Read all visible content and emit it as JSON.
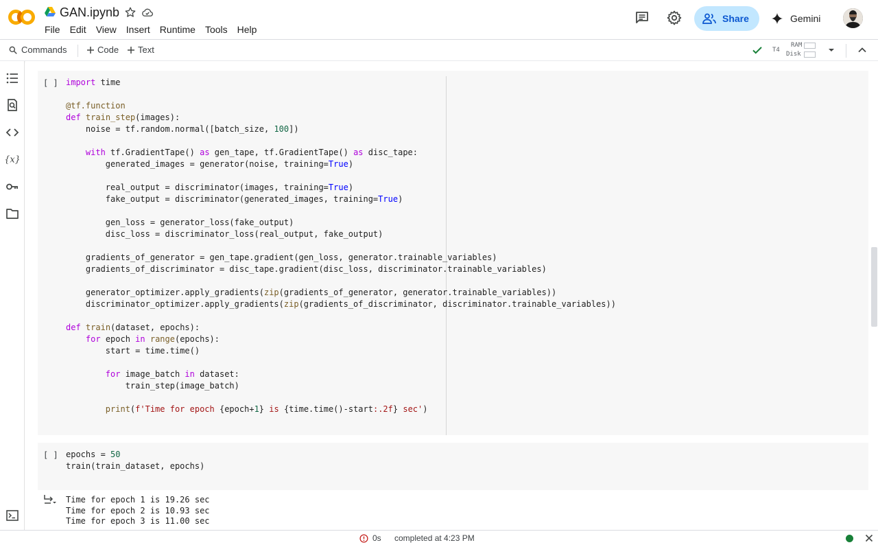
{
  "header": {
    "title": "GAN.ipynb",
    "menu": [
      "File",
      "Edit",
      "View",
      "Insert",
      "Runtime",
      "Tools",
      "Help"
    ],
    "share_label": "Share",
    "gemini_label": "Gemini"
  },
  "toolbar": {
    "commands_label": "Commands",
    "add_code_label": "Code",
    "add_text_label": "Text",
    "runtime_type": "T4",
    "ram_label": "RAM",
    "disk_label": "Disk"
  },
  "cells": [
    {
      "run_indicator": "[ ]",
      "lines": [
        "import time",
        "",
        "@tf.function",
        "def train_step(images):",
        "    noise = tf.random.normal([batch_size, 100])",
        "",
        "    with tf.GradientTape() as gen_tape, tf.GradientTape() as disc_tape:",
        "        generated_images = generator(noise, training=True)",
        "",
        "        real_output = discriminator(images, training=True)",
        "        fake_output = discriminator(generated_images, training=True)",
        "",
        "        gen_loss = generator_loss(fake_output)",
        "        disc_loss = discriminator_loss(real_output, fake_output)",
        "",
        "    gradients_of_generator = gen_tape.gradient(gen_loss, generator.trainable_variables)",
        "    gradients_of_discriminator = disc_tape.gradient(disc_loss, discriminator.trainable_variables)",
        "",
        "    generator_optimizer.apply_gradients(zip(gradients_of_generator, generator.trainable_variables))",
        "    discriminator_optimizer.apply_gradients(zip(gradients_of_discriminator, discriminator.trainable_variables))",
        "",
        "def train(dataset, epochs):",
        "    for epoch in range(epochs):",
        "        start = time.time()",
        "",
        "        for image_batch in dataset:",
        "            train_step(image_batch)",
        "",
        "        print(f'Time for epoch {epoch+1} is {time.time()-start:.2f} sec')"
      ]
    },
    {
      "run_indicator": "[ ]",
      "lines": [
        "epochs = 50",
        "train(train_dataset, epochs)"
      ],
      "output": [
        "Time for epoch 1 is 19.26 sec",
        "Time for epoch 2 is 10.93 sec",
        "Time for epoch 3 is 11.00 sec"
      ]
    }
  ],
  "status": {
    "elapsed": "0s",
    "completed": "completed at 4:23 PM"
  }
}
